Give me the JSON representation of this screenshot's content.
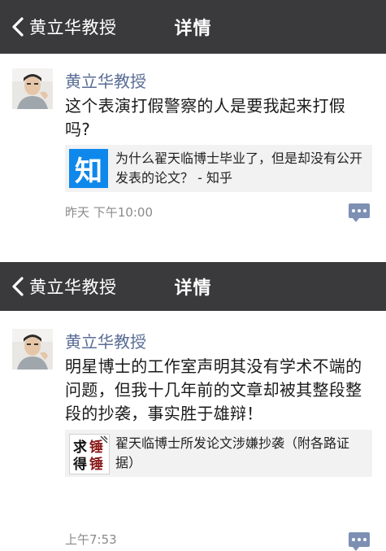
{
  "shots": [
    {
      "nav": {
        "back_label": "黄立华教授",
        "title": "详情"
      },
      "post": {
        "author": "黄立华教授",
        "content": "这个表演打假警察的人是要我起来打假吗?",
        "link": {
          "thumb_icon": "zhihu-logo-icon",
          "thumb_text": "知",
          "text": "为什么翟天临博士毕业了，但是却没有公开发表的论文？ - 知乎"
        },
        "timestamp": "昨天 下午10:00"
      }
    },
    {
      "nav": {
        "back_label": "黄立华教授",
        "title": "详情"
      },
      "post": {
        "author": "黄立华教授",
        "content": "明星博士的工作室声明其没有学术不端的问题，但我十几年前的文章却被其整段整段的抄袭，事实胜于雄辩！",
        "link": {
          "thumb_icon": "seal-logo-icon",
          "thumb_text": "求锤得锤",
          "text": "翟天临博士所发论文涉嫌抄袭（附各路证据）"
        },
        "timestamp": "上午7:53"
      }
    }
  ],
  "colors": {
    "nav_bg": "#3a3a3c",
    "author": "#5a6d96",
    "link_bg": "#f2f2f3",
    "zhihu_blue": "#0f88eb",
    "comment_icon": "#7d8fb3"
  }
}
